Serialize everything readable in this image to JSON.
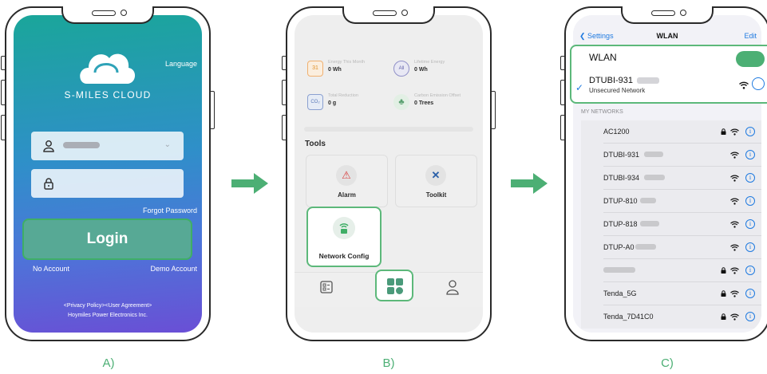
{
  "captions": [
    "A)",
    "B)",
    "C)"
  ],
  "login": {
    "language_label": "Language",
    "brand": "S-MILES CLOUD",
    "forgot_password": "Forgot Password",
    "login_button": "Login",
    "no_account": "No Account",
    "demo_account": "Demo Account",
    "privacy_links": "<Privacy Policy><User Agreement>",
    "company": "Hoymiles Power Electronics Inc."
  },
  "dashboard": {
    "stats": [
      {
        "label": "Energy This Month",
        "value": "0 Wh",
        "icon": "calendar-icon"
      },
      {
        "label": "Lifetime Energy",
        "value": "0 Wh",
        "icon": "all-icon"
      },
      {
        "label": "Total Reduction",
        "value": "0 g",
        "icon": "co2-icon"
      },
      {
        "label": "Carbon Emission Offset",
        "value": "0 Trees",
        "icon": "tree-icon"
      }
    ],
    "tools_title": "Tools",
    "tools": [
      {
        "label": "Alarm",
        "icon": "alarm-icon"
      },
      {
        "label": "Toolkit",
        "icon": "toolkit-icon"
      },
      {
        "label": "Network Config",
        "icon": "router-icon"
      }
    ]
  },
  "wlan": {
    "back_label": "Settings",
    "title": "WLAN",
    "edit_label": "Edit",
    "wlan_label": "WLAN",
    "wlan_enabled": true,
    "current_network": {
      "name": "DTUBI-931",
      "status": "Unsecured Network"
    },
    "section_title": "MY NETWORKS",
    "networks": [
      {
        "name": "AC1200",
        "locked": true
      },
      {
        "name": "DTUBI-931",
        "locked": false
      },
      {
        "name": "DTUBI-934",
        "locked": false
      },
      {
        "name": "DTUP-810",
        "locked": false
      },
      {
        "name": "DTUP-818",
        "locked": false
      },
      {
        "name": "DTUP-A0",
        "locked": false
      },
      {
        "name": "",
        "locked": true
      },
      {
        "name": "Tenda_5G",
        "locked": true
      },
      {
        "name": "Tenda_7D41C0",
        "locked": true
      }
    ]
  },
  "colors": {
    "highlight": "#5cb87a",
    "accent_blue": "#1f7ae0",
    "caption": "#4caf74"
  }
}
